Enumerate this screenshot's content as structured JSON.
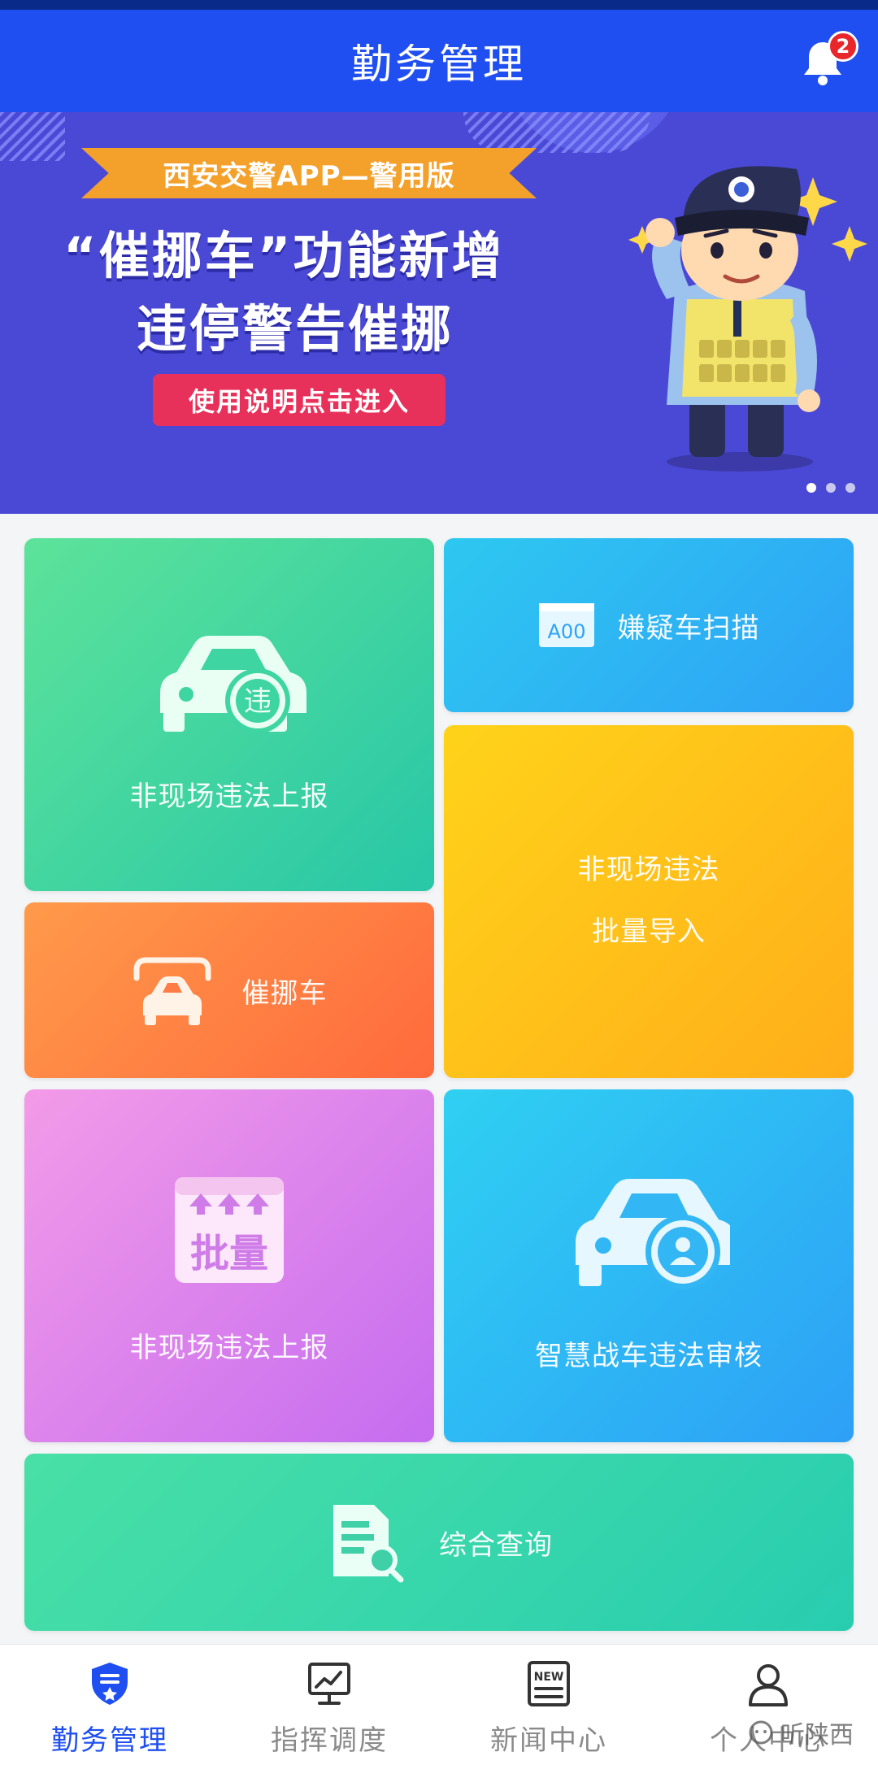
{
  "header": {
    "title": "勤务管理",
    "notification_count": "2"
  },
  "banner": {
    "ribbon": "西安交警APP—警用版",
    "headline_line1": "“催挪车”功能新增",
    "headline_line2": "违停警告催挪",
    "cta": "使用说明点击进入",
    "carousel_pages": 3,
    "carousel_active": 1
  },
  "tiles": {
    "offsite_report": "非现场违法上报",
    "offsite_report_badge": "违",
    "suspect_scan": "嫌疑车扫描",
    "suspect_scan_plate": "A00",
    "batch_import_line1": "非现场违法",
    "batch_import_line2": "批量导入",
    "move_car": "催挪车",
    "batch_report": "非现场违法上报",
    "batch_badge": "批量",
    "smart_review": "智慧战车违法审核",
    "query": "综合查询"
  },
  "tabbar": {
    "items": [
      {
        "label": "勤务管理",
        "icon": "shield-star-icon",
        "active": true
      },
      {
        "label": "指挥调度",
        "icon": "monitor-chart-icon",
        "active": false
      },
      {
        "label": "新闻中心",
        "icon": "news-icon",
        "active": false
      },
      {
        "label": "个人中心",
        "icon": "person-icon",
        "active": false
      }
    ],
    "new_tag": "NEW"
  },
  "watermark": "听陕西",
  "colors": {
    "primary": "#1f4ff0",
    "badge": "#e8262b"
  }
}
